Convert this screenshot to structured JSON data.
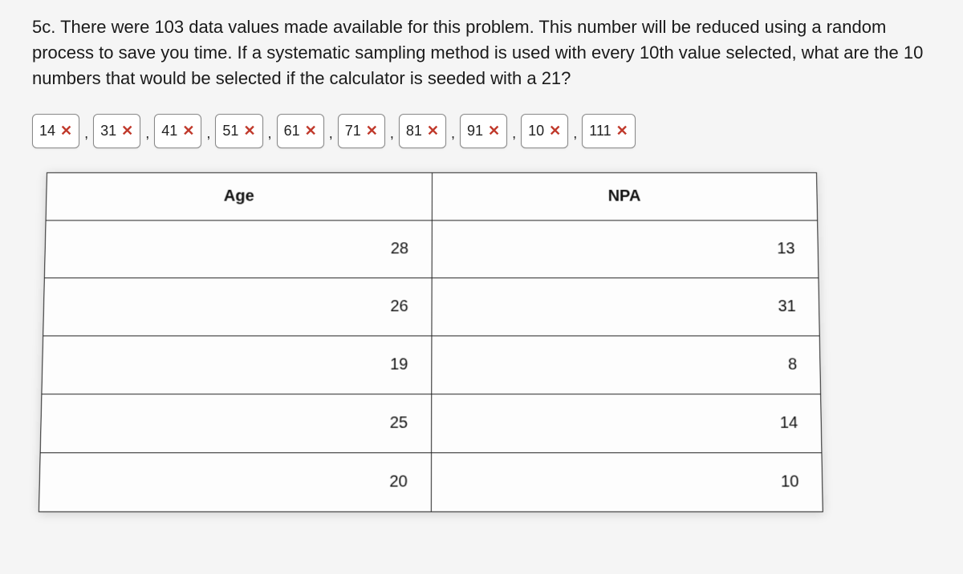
{
  "question": "5c. There were 103 data values made available for this problem. This number will be reduced using a random process to save you time. If a systematic sampling method is used with every 10th value selected, what are the 10 numbers that would be selected if the calculator is seeded with a 21?",
  "answers": [
    "14",
    "31",
    "41",
    "51",
    "61",
    "71",
    "81",
    "91",
    "10",
    "111"
  ],
  "x_mark": "✕",
  "sep": ",",
  "table": {
    "col1": "Age",
    "col2": "NPA",
    "rows": [
      {
        "age": "28",
        "npa": "13"
      },
      {
        "age": "26",
        "npa": "31"
      },
      {
        "age": "19",
        "npa": "8"
      },
      {
        "age": "25",
        "npa": "14"
      },
      {
        "age": "20",
        "npa": "10"
      }
    ]
  }
}
